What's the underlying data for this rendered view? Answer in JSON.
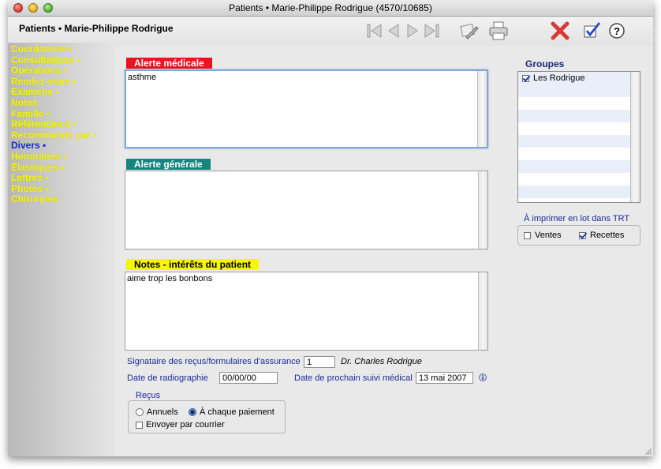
{
  "window": {
    "title": "Patients • Marie-Philippe Rodrigue (4570/10685)"
  },
  "header": {
    "title": "Patients • Marie-Philippe Rodrigue",
    "toolbar": [
      {
        "icon": "first-record-icon"
      },
      {
        "icon": "previous-record-icon"
      },
      {
        "icon": "next-record-icon"
      },
      {
        "icon": "last-record-icon"
      },
      {
        "icon": "edit-document-icon"
      },
      {
        "icon": "print-icon"
      },
      {
        "icon": "delete-icon"
      },
      {
        "icon": "validate-icon"
      },
      {
        "icon": "help-icon"
      }
    ],
    "help_label": "?"
  },
  "sidebar": {
    "items": [
      {
        "label": "Coordonnées",
        "dot": ""
      },
      {
        "label": "Consultations",
        "dot": " •"
      },
      {
        "label": "Opérations",
        "dot": " •"
      },
      {
        "label": "Rendez-vous",
        "dot": " •"
      },
      {
        "label": "Examens",
        "dot": " •"
      },
      {
        "label": "Notes",
        "dot": ""
      },
      {
        "label": "Famille",
        "dot": " •"
      },
      {
        "label": "Références à",
        "dot": " •"
      },
      {
        "label": "Recommandé par",
        "dot": " •"
      },
      {
        "label": "Divers",
        "dot": " •",
        "active": true
      },
      {
        "label": "Honoraires",
        "dot": " •"
      },
      {
        "label": "Élastiques",
        "dot": " •"
      },
      {
        "label": "Lettres",
        "dot": " •"
      },
      {
        "label": "Photos",
        "dot": " •"
      },
      {
        "label": "Chirurgies",
        "dot": ""
      }
    ]
  },
  "alerte_medicale": {
    "label": "Alerte médicale",
    "value": "asthme",
    "color": "#e8141f"
  },
  "alerte_generale": {
    "label": "Alerte générale",
    "value": "",
    "color": "#16857f"
  },
  "notes": {
    "label": "Notes - intérêts du patient",
    "value": "aime trop les bonbons",
    "color": "#f7f700"
  },
  "signataire": {
    "label": "Signataire des reçus/formulaires d'assurance",
    "value": "1",
    "doctor": "Dr. Charles Rodrigue"
  },
  "radiographie": {
    "label": "Date de radiographie",
    "value": "00/00/00"
  },
  "suivi": {
    "label": "Date de prochain suivi médical",
    "value": "13 mai 2007"
  },
  "recus": {
    "title": "Reçus",
    "options": [
      {
        "label": "Annuels",
        "selected": false
      },
      {
        "label": "À chaque paiement",
        "selected": true
      }
    ],
    "envoyer_label": "Envoyer par courrier",
    "envoyer_checked": false
  },
  "groupes": {
    "title": "Groupes",
    "items": [
      {
        "label": "Les Rodrigue",
        "checked": true
      }
    ]
  },
  "imprimer": {
    "title": "À imprimer en lot dans TRT",
    "ventes_label": "Ventes",
    "ventes_checked": false,
    "recettes_label": "Recettes",
    "recettes_checked": true
  }
}
